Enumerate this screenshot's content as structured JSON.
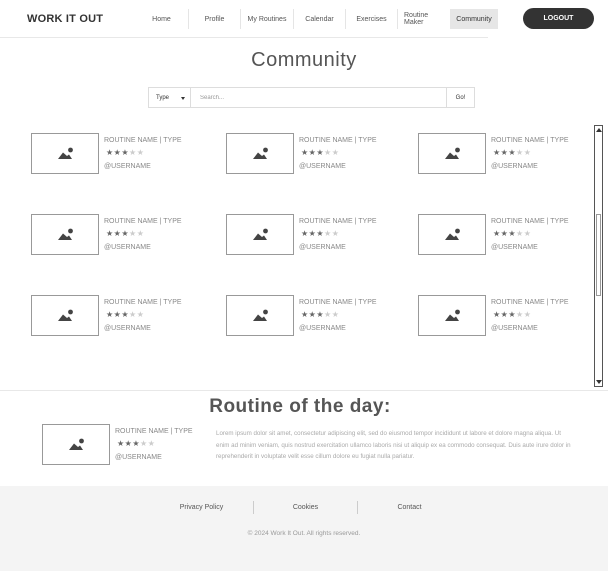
{
  "header": {
    "brand": "WORK IT OUT",
    "nav": [
      "Home",
      "Profile",
      "My Routines",
      "Calendar",
      "Exercises",
      "Routine Maker",
      "Community"
    ],
    "active_nav": "Community",
    "logout_label": "LOGOUT"
  },
  "page": {
    "title": "Community"
  },
  "search": {
    "type_label": "Type",
    "placeholder": "Search...",
    "go_label": "Go!"
  },
  "routines": [
    {
      "title": "ROUTINE NAME  | TYPE",
      "rating": 3,
      "max_rating": 5,
      "user": "@USERNAME"
    },
    {
      "title": "ROUTINE NAME  | TYPE",
      "rating": 3,
      "max_rating": 5,
      "user": "@USERNAME"
    },
    {
      "title": "ROUTINE NAME  | TYPE",
      "rating": 3,
      "max_rating": 5,
      "user": "@USERNAME"
    },
    {
      "title": "ROUTINE NAME  | TYPE",
      "rating": 3,
      "max_rating": 5,
      "user": "@USERNAME"
    },
    {
      "title": "ROUTINE NAME  | TYPE",
      "rating": 3,
      "max_rating": 5,
      "user": "@USERNAME"
    },
    {
      "title": "ROUTINE NAME  | TYPE",
      "rating": 3,
      "max_rating": 5,
      "user": "@USERNAME"
    },
    {
      "title": "ROUTINE NAME  | TYPE",
      "rating": 3,
      "max_rating": 5,
      "user": "@USERNAME"
    },
    {
      "title": "ROUTINE NAME  | TYPE",
      "rating": 3,
      "max_rating": 5,
      "user": "@USERNAME"
    },
    {
      "title": "ROUTINE NAME  | TYPE",
      "rating": 3,
      "max_rating": 5,
      "user": "@USERNAME"
    }
  ],
  "routine_of_day": {
    "heading": "Routine of the day:",
    "title": "ROUTINE NAME  | TYPE",
    "rating": 3,
    "max_rating": 5,
    "user": "@USERNAME",
    "description": "Lorem ipsum dolor sit amet, consectetur adipiscing elit, sed do eiusmod tempor incididunt ut labore et dolore magna aliqua. Ut enim ad minim veniam, quis nostrud exercitation ullamco laboris nisi ut aliquip ex ea commodo consequat. Duis aute irure dolor in reprehenderit in voluptate velit esse cillum dolore eu fugiat nulla pariatur."
  },
  "footer": {
    "links": [
      "Privacy Policy",
      "Cookies",
      "Contact"
    ],
    "copyright": "© 2024 Work It Out.  All rights reserved."
  },
  "icons": {
    "thumbnail": "image-placeholder-icon",
    "dropdown": "caret-down-icon",
    "scroll_up": "arrow-up-icon",
    "scroll_down": "arrow-down-icon"
  },
  "colors": {
    "logout_bg": "#333333",
    "active_nav_bg": "#e6e6e6",
    "footer_bg": "#f4f4f4"
  }
}
